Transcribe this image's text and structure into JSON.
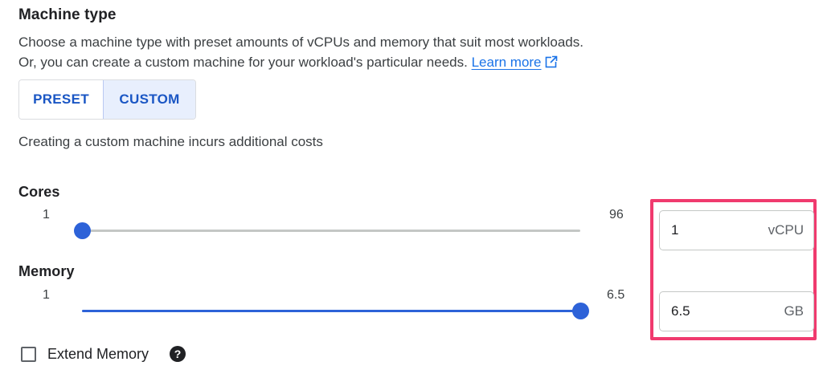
{
  "section": {
    "title": "Machine type",
    "description_line1": "Choose a machine type with preset amounts of vCPUs and memory that suit most workloads.",
    "description_line2": "Or, you can create a custom machine for your workload's particular needs.",
    "learn_more": "Learn more"
  },
  "toggle": {
    "preset_label": "PRESET",
    "custom_label": "CUSTOM",
    "selected": "CUSTOM"
  },
  "note": "Creating a custom machine incurs additional costs",
  "cores": {
    "label": "Cores",
    "min": "1",
    "max": "96",
    "value": "1",
    "unit": "vCPU",
    "level": 0
  },
  "memory": {
    "label": "Memory",
    "min": "1",
    "max": "6.5",
    "value": "6.5",
    "unit": "GB",
    "level": 1
  },
  "extend_memory": {
    "label": "Extend Memory",
    "checked": false,
    "help_icon": "help-circle-icon"
  },
  "colors": {
    "accent": "#2d62d8",
    "highlight": "#f03a6e",
    "link": "#1a73e8"
  }
}
